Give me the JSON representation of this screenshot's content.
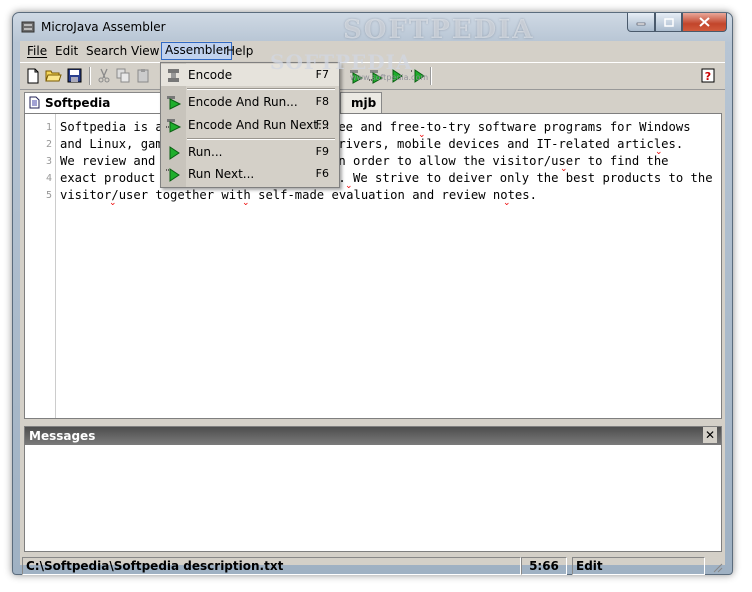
{
  "window": {
    "title": "MicroJava Assembler"
  },
  "watermark": {
    "text": "SOFTPEDIA",
    "url": "www.softpedia.com"
  },
  "menu": [
    {
      "label": "File",
      "mnemonic": "F"
    },
    {
      "label": "Edit",
      "mnemonic": "E"
    },
    {
      "label": "Search",
      "mnemonic": "S"
    },
    {
      "label": "View",
      "mnemonic": "V"
    },
    {
      "label": "Assembler",
      "mnemonic": "A"
    },
    {
      "label": "Help",
      "mnemonic": "H"
    }
  ],
  "assembler_menu": [
    {
      "label": "Encode",
      "shortcut": "F7",
      "icon": "encode-icon"
    },
    {
      "label": "Encode And Run...",
      "shortcut": "F8",
      "icon": "encode-run-icon"
    },
    {
      "label": "Encode And Run Next...",
      "shortcut": "F9",
      "icon": "encode-run-next-icon"
    },
    {
      "label": "Run...",
      "shortcut": "F9",
      "icon": "run-icon"
    },
    {
      "label": "Run Next...",
      "shortcut": "F6",
      "icon": "run-next-icon"
    }
  ],
  "tabs": [
    {
      "label": "Softpedia descriptio"
    },
    {
      "label": "mjb"
    }
  ],
  "editor": {
    "line_numbers": [
      "1",
      "2",
      "3",
      "4",
      "5"
    ],
    "lines": [
      "Softpedia is a",
      "and Linux, game",
      "We review and c",
      "exact product t",
      "visitor/user together with self-made evaluation and review notes."
    ],
    "lines_right": [
      "ree and free-to-try software programs for Windows",
      "drivers, mobile devices and IT-related articles.",
      "in order to allow the visitor/user to find the",
      "s. We strive to deiver only the best products to the",
      ""
    ]
  },
  "messages": {
    "title": "Messages",
    "close": "✕"
  },
  "status": {
    "path": "C:\\Softpedia\\Softpedia description.txt",
    "position": "5:66",
    "mode": "Edit"
  },
  "colors": {
    "accent": "#316ac5",
    "menu_bg": "#d4d0c8",
    "run_green": "#1fae2c"
  }
}
